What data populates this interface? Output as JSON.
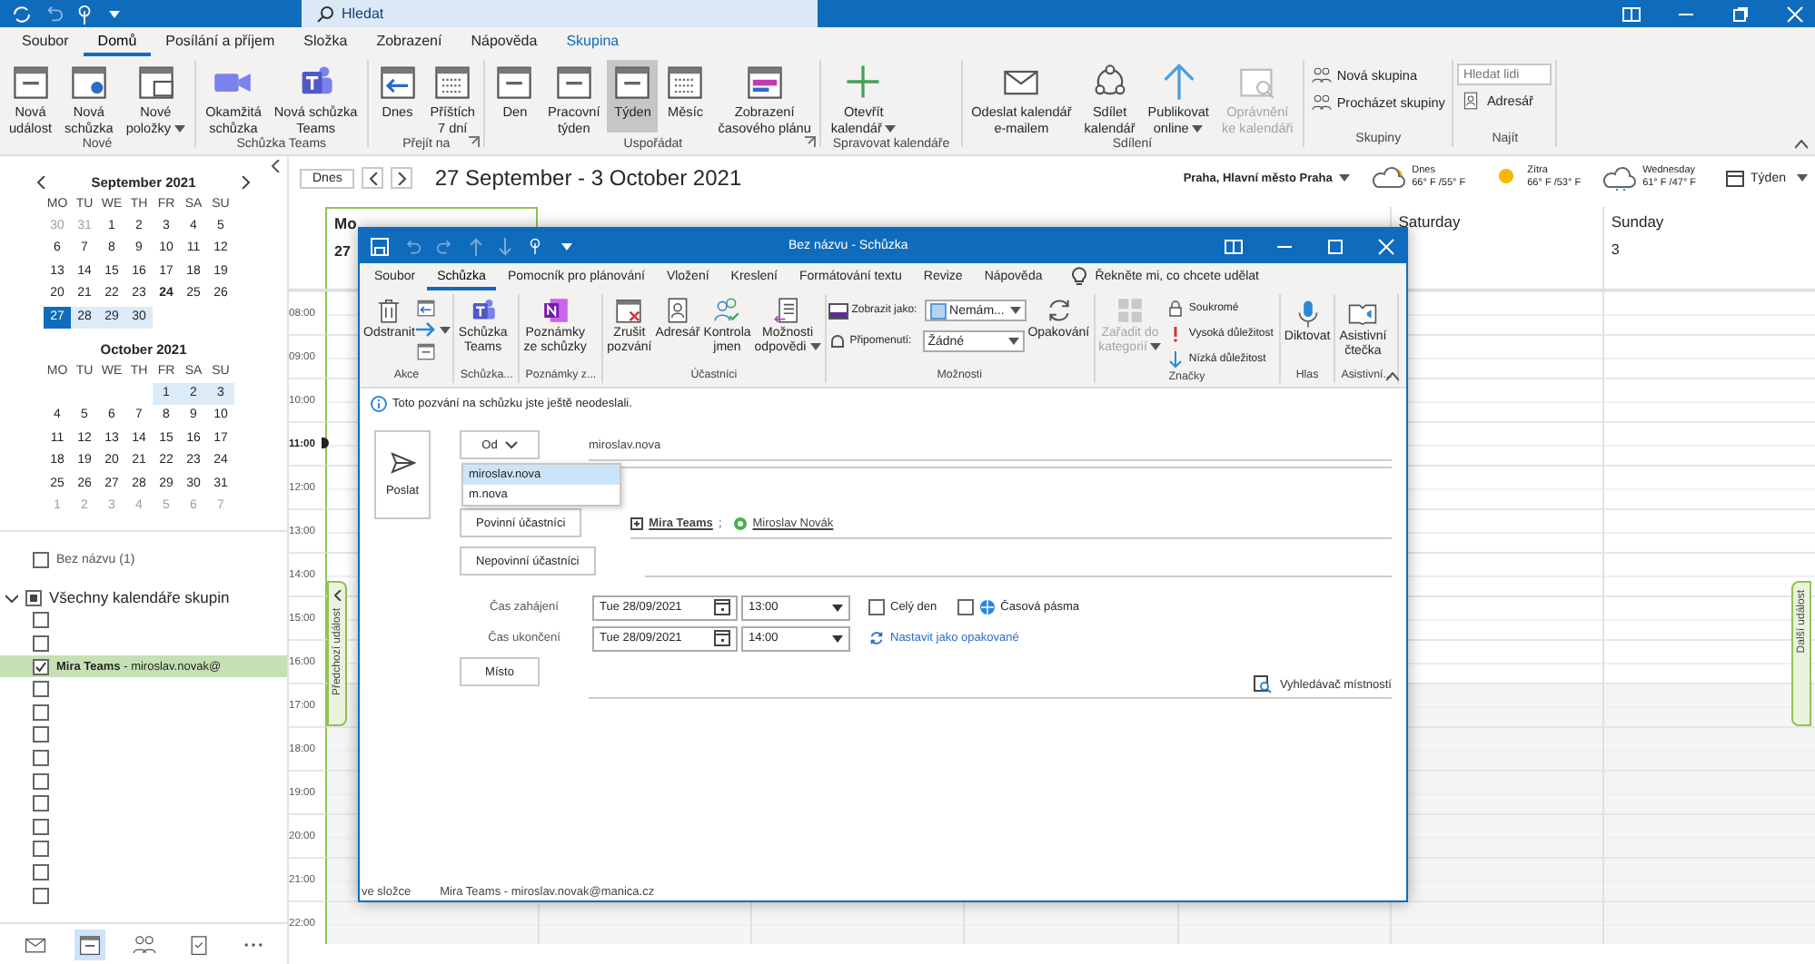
{
  "title_bar": {
    "search": {
      "placeholder": "Hledat"
    }
  },
  "ribbon_tabs": [
    {
      "label": "Soubor",
      "selected": false,
      "kind": "tab"
    },
    {
      "label": "Domů",
      "selected": true,
      "kind": "tab"
    },
    {
      "label": "Posílání a příjem",
      "selected": false,
      "kind": "tab"
    },
    {
      "label": "Složka",
      "selected": false,
      "kind": "tab"
    },
    {
      "label": "Zobrazení",
      "selected": false,
      "kind": "tab"
    },
    {
      "label": "Nápověda",
      "selected": false,
      "kind": "tab"
    },
    {
      "label": "Skupina",
      "selected": false,
      "kind": "contextual"
    }
  ],
  "ribbon_groups": [
    {
      "name": "Nové",
      "launcher": false,
      "items": [
        {
          "kind": "large",
          "label": "Nová\nudálost"
        },
        {
          "kind": "large",
          "label": "Nová\nschůzka"
        },
        {
          "kind": "large",
          "label": "Nové\npoložky",
          "dropdown": true
        }
      ]
    },
    {
      "name": "Schůzka Teams",
      "launcher": false,
      "items": [
        {
          "kind": "large",
          "label": "Okamžitá\nschůzka"
        },
        {
          "kind": "large",
          "label": "Nová schůzka\nTeams"
        }
      ]
    },
    {
      "name": "Přejít na",
      "launcher": true,
      "items": [
        {
          "kind": "large",
          "label": "Dnes"
        },
        {
          "kind": "large",
          "label": "Příštích\n7 dní"
        }
      ]
    },
    {
      "name": "Uspořádat",
      "launcher": true,
      "items": [
        {
          "kind": "large",
          "label": "Den",
          "selected": false
        },
        {
          "kind": "large",
          "label": "Pracovní\ntýden",
          "selected": false
        },
        {
          "kind": "large",
          "label": "Týden",
          "selected": true
        },
        {
          "kind": "large",
          "label": "Měsíc",
          "selected": false
        },
        {
          "kind": "large",
          "label": "Zobrazení\nčasového plánu",
          "selected": false
        }
      ]
    },
    {
      "name": "Spravovat kalendáře",
      "launcher": false,
      "items": [
        {
          "kind": "large",
          "label": "Otevřít\nkalendář",
          "dropdown": true
        }
      ]
    },
    {
      "name": "Sdílení",
      "launcher": false,
      "items": [
        {
          "kind": "large",
          "label": "Odeslat kalendář\ne-mailem",
          "disabled": false
        },
        {
          "kind": "large",
          "label": "Sdílet\nkalendář",
          "disabled": false
        },
        {
          "kind": "large",
          "label": "Publikovat\nonline",
          "dropdown": true,
          "disabled": false
        },
        {
          "kind": "large",
          "label": "Oprávnění\nke kalendáři",
          "disabled": true
        }
      ]
    },
    {
      "name": "Skupiny",
      "launcher": false,
      "items": [
        {
          "kind": "small",
          "label": "Nová skupina"
        },
        {
          "kind": "small",
          "label": "Procházet skupiny"
        }
      ]
    },
    {
      "name": "Najít",
      "launcher": false,
      "items": [
        {
          "kind": "field",
          "placeholder": "Hledat lidi"
        },
        {
          "kind": "small",
          "label": "Adresář"
        }
      ]
    }
  ],
  "mini_calendars": [
    {
      "title": "September 2021",
      "arrows": true,
      "weekdays": [
        "MO",
        "TU",
        "WE",
        "TH",
        "FR",
        "SA",
        "SU"
      ],
      "weeks": [
        [
          {
            "day": "30",
            "kind": "other"
          },
          {
            "day": "31",
            "kind": "other"
          },
          {
            "day": "1",
            "kind": "normal"
          },
          {
            "day": "2",
            "kind": "normal"
          },
          {
            "day": "3",
            "kind": "normal"
          },
          {
            "day": "4",
            "kind": "normal"
          },
          {
            "day": "5",
            "kind": "normal"
          }
        ],
        [
          {
            "day": "6",
            "kind": "normal"
          },
          {
            "day": "7",
            "kind": "normal"
          },
          {
            "day": "8",
            "kind": "normal"
          },
          {
            "day": "9",
            "kind": "normal"
          },
          {
            "day": "10",
            "kind": "normal"
          },
          {
            "day": "11",
            "kind": "normal"
          },
          {
            "day": "12",
            "kind": "normal"
          }
        ],
        [
          {
            "day": "13",
            "kind": "normal"
          },
          {
            "day": "14",
            "kind": "normal"
          },
          {
            "day": "15",
            "kind": "normal"
          },
          {
            "day": "16",
            "kind": "normal"
          },
          {
            "day": "17",
            "kind": "normal"
          },
          {
            "day": "18",
            "kind": "normal"
          },
          {
            "day": "19",
            "kind": "normal"
          }
        ],
        [
          {
            "day": "20",
            "kind": "normal"
          },
          {
            "day": "21",
            "kind": "normal"
          },
          {
            "day": "22",
            "kind": "normal"
          },
          {
            "day": "23",
            "kind": "normal"
          },
          {
            "day": "24",
            "kind": "today"
          },
          {
            "day": "25",
            "kind": "normal"
          },
          {
            "day": "26",
            "kind": "normal"
          }
        ],
        [
          {
            "day": "27",
            "kind": "selected"
          },
          {
            "day": "28",
            "kind": "range"
          },
          {
            "day": "29",
            "kind": "range"
          },
          {
            "day": "30",
            "kind": "range"
          }
        ]
      ]
    },
    {
      "title": "October 2021",
      "arrows": false,
      "weekdays": [
        "MO",
        "TU",
        "WE",
        "TH",
        "FR",
        "SA",
        "SU"
      ],
      "weeks": [
        [
          {
            "day": "1",
            "kind": "range"
          },
          {
            "day": "2",
            "kind": "range"
          },
          {
            "day": "3",
            "kind": "range"
          }
        ],
        [
          {
            "day": "4",
            "kind": "normal"
          },
          {
            "day": "5",
            "kind": "normal"
          },
          {
            "day": "6",
            "kind": "normal"
          },
          {
            "day": "7",
            "kind": "normal"
          },
          {
            "day": "8",
            "kind": "normal"
          },
          {
            "day": "9",
            "kind": "normal"
          },
          {
            "day": "10",
            "kind": "normal"
          }
        ],
        [
          {
            "day": "11",
            "kind": "normal"
          },
          {
            "day": "12",
            "kind": "normal"
          },
          {
            "day": "13",
            "kind": "normal"
          },
          {
            "day": "14",
            "kind": "normal"
          },
          {
            "day": "15",
            "kind": "normal"
          },
          {
            "day": "16",
            "kind": "normal"
          },
          {
            "day": "17",
            "kind": "normal"
          }
        ],
        [
          {
            "day": "18",
            "kind": "normal"
          },
          {
            "day": "19",
            "kind": "normal"
          },
          {
            "day": "20",
            "kind": "normal"
          },
          {
            "day": "21",
            "kind": "normal"
          },
          {
            "day": "22",
            "kind": "normal"
          },
          {
            "day": "23",
            "kind": "normal"
          },
          {
            "day": "24",
            "kind": "normal"
          }
        ],
        [
          {
            "day": "25",
            "kind": "normal"
          },
          {
            "day": "26",
            "kind": "normal"
          },
          {
            "day": "27",
            "kind": "normal"
          },
          {
            "day": "28",
            "kind": "normal"
          },
          {
            "day": "29",
            "kind": "normal"
          },
          {
            "day": "30",
            "kind": "normal"
          },
          {
            "day": "31",
            "kind": "normal"
          }
        ],
        [
          {
            "day": "1",
            "kind": "other"
          },
          {
            "day": "2",
            "kind": "other"
          },
          {
            "day": "3",
            "kind": "other"
          },
          {
            "day": "4",
            "kind": "other"
          },
          {
            "day": "5",
            "kind": "other"
          },
          {
            "day": "6",
            "kind": "other"
          },
          {
            "day": "7",
            "kind": "other"
          }
        ]
      ]
    }
  ],
  "folders": {
    "single": {
      "label": "Bez názvu (1)",
      "checked": false
    },
    "group": {
      "label": "Všechny kalendáře skupin",
      "expanded": true,
      "partially_checked": true,
      "items": [
        {
          "checked": false,
          "selected": false
        },
        {
          "checked": false,
          "selected": false
        },
        {
          "label": "**Mira Teams** - miroslav.novak@",
          "checked": true,
          "selected": true
        },
        {
          "checked": false,
          "selected": false
        },
        {
          "checked": false,
          "selected": false
        },
        {
          "checked": false,
          "selected": false
        },
        {
          "checked": false,
          "selected": false
        },
        {
          "checked": false,
          "selected": false
        },
        {
          "checked": false,
          "selected": false
        },
        {
          "checked": false,
          "selected": false
        },
        {
          "checked": false,
          "selected": false
        },
        {
          "checked": false,
          "selected": false
        },
        {
          "checked": false,
          "selected": false
        }
      ]
    }
  },
  "nav_bar": [
    {
      "selected": false
    },
    {
      "selected": true
    },
    {
      "selected": false
    },
    {
      "selected": false
    },
    {
      "selected": false
    }
  ],
  "calendar": {
    "today_button": "Dnes",
    "range_title": "27 September - 3 October 2021",
    "location": "Praha, Hlavní město Praha",
    "weather": [
      {
        "day": "Dnes",
        "temps": "66° F /55° F",
        "kind": "cloud-sun"
      },
      {
        "day": "Zítra",
        "temps": "66° F /53° F",
        "kind": "sun"
      },
      {
        "day": "Wednesday",
        "temps": "61° F /47° F",
        "kind": "rain"
      }
    ],
    "view": "Týden",
    "days": [
      {
        "name": "Mo",
        "date": "27",
        "selected": true
      },
      {
        "name": "Saturday",
        "selected": false
      },
      {
        "name": "Sunday",
        "date": "3",
        "selected": false
      }
    ],
    "hours": [
      {
        "time": "08:00",
        "current": false,
        "working": true
      },
      {
        "time": "09:00",
        "current": false,
        "working": true
      },
      {
        "time": "10:00",
        "current": false,
        "working": true
      },
      {
        "time": "11:00",
        "current": true,
        "working": true
      },
      {
        "time": "12:00",
        "current": false,
        "working": true
      },
      {
        "time": "13:00",
        "current": false,
        "working": true
      },
      {
        "time": "14:00",
        "current": false,
        "working": true
      },
      {
        "time": "15:00",
        "current": false,
        "working": true
      },
      {
        "time": "16:00",
        "current": false,
        "working": true
      },
      {
        "time": "17:00",
        "current": false,
        "working": false
      },
      {
        "time": "18:00",
        "current": false,
        "working": false
      },
      {
        "time": "19:00",
        "current": false,
        "working": false
      },
      {
        "time": "20:00",
        "current": false,
        "working": false
      },
      {
        "time": "21:00",
        "current": false,
        "working": false
      },
      {
        "time": "22:00",
        "current": false,
        "working": false
      }
    ],
    "previous_event": "Předchozí událost",
    "next_event": "Další událost"
  },
  "meeting_window": {
    "title": "Bez názvu - Schůzka",
    "tabs": [
      {
        "label": "Soubor",
        "selected": false
      },
      {
        "label": "Schůzka",
        "selected": true
      },
      {
        "label": "Pomocník pro plánování",
        "selected": false
      },
      {
        "label": "Vložení",
        "selected": false
      },
      {
        "label": "Kreslení",
        "selected": false
      },
      {
        "label": "Formátování textu",
        "selected": false
      },
      {
        "label": "Revize",
        "selected": false
      },
      {
        "label": "Nápověda",
        "selected": false
      }
    ],
    "tell_me": "Řekněte mi, co chcete udělat",
    "groups": [
      {
        "name": "Akce",
        "items": [
          {
            "kind": "large",
            "label": "Odstranit"
          },
          {
            "kind": "stack"
          }
        ]
      },
      {
        "name": "Schůzka...",
        "items": [
          {
            "kind": "large",
            "label": "Schůzka\nTeams"
          }
        ]
      },
      {
        "name": "Poznámky z...",
        "items": [
          {
            "kind": "large",
            "label": "Poznámky\nze schůzky"
          }
        ]
      },
      {
        "name": "Účastníci",
        "items": [
          {
            "kind": "large",
            "label": "Zrušit\npozvání"
          },
          {
            "kind": "large",
            "label": "Adresář"
          },
          {
            "kind": "large",
            "label": "Kontrola\njmen"
          },
          {
            "kind": "large",
            "label": "Možnosti\nodpovědi",
            "dropdown": true
          }
        ]
      },
      {
        "name": "Možnosti",
        "items": [
          {
            "kind": "combos",
            "rows": [
              {
                "label": "Zobrazit jako:",
                "value": "Nemám..."
              },
              {
                "label": "Připomenutí:",
                "value": "Žádné"
              }
            ]
          },
          {
            "kind": "large",
            "label": "Opakování"
          }
        ]
      },
      {
        "name": "Značky",
        "items": [
          {
            "kind": "large",
            "label": "Zařadit do\nkategorií",
            "dropdown": true,
            "disabled": true
          },
          {
            "kind": "smalls",
            "rows": [
              "Soukromé",
              "Vysoká důležitost",
              "Nízká důležitost"
            ]
          }
        ]
      },
      {
        "name": "Hlas",
        "items": [
          {
            "kind": "large",
            "label": "Diktovat"
          }
        ]
      },
      {
        "name": "Asistivní...",
        "items": [
          {
            "kind": "large",
            "label": "Asistivní\nčtečka"
          }
        ]
      }
    ],
    "info": "Toto pozvání na schůzku jste ještě neodeslali.",
    "send": "Poslat",
    "from_button": "Od",
    "from_value": "miroslav.nova",
    "from_menu": [
      {
        "label": "miroslav.nova",
        "selected": true
      },
      {
        "label": "m.nova",
        "selected": false
      }
    ],
    "required_button": "Povinní účastníci",
    "required": [
      {
        "name": "Mira Teams",
        "kind": "group",
        "separator": ";"
      },
      {
        "name": "Miroslav Novák",
        "kind": "person",
        "color": "#4caf50"
      }
    ],
    "optional_button": "Nepovinní účastníci",
    "start": {
      "label": "Čas zahájení",
      "date": "Tue 28/09/2021",
      "time": "13:00"
    },
    "end": {
      "label": "Čas ukončení",
      "date": "Tue 28/09/2021",
      "time": "14:00"
    },
    "all_day": {
      "label": "Celý den",
      "checked": false
    },
    "time_zones": {
      "label": "Časová pásma",
      "checked": false
    },
    "recurrence_link": "Nastavit jako opakované",
    "location_button": "Místo",
    "room_finder": "Vyhledávač místností",
    "status": {
      "folder_label": "ve složce",
      "folder": "Mira Teams - miroslav.novak@manica.cz"
    }
  }
}
